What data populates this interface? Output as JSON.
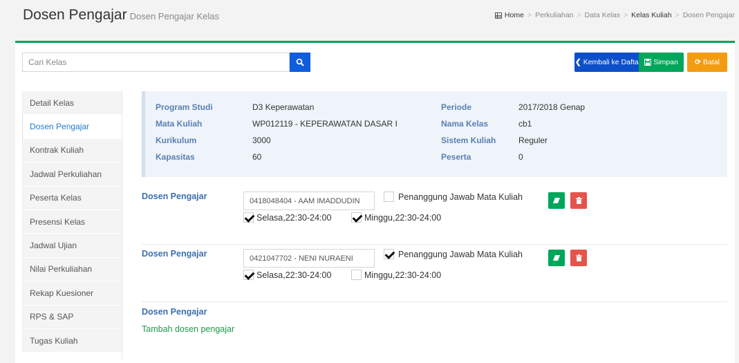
{
  "header": {
    "title": "Dosen Pengajar",
    "subtitle": "Dosen Pengajar Kelas",
    "breadcrumb": [
      "Home",
      "Perkuliahan",
      "Data Kelas",
      "Kelas Kuliah",
      "Dosen Pengajar"
    ]
  },
  "toolbar": {
    "search_placeholder": "Cari Kelas",
    "back_label": "Kembali ke Daftar",
    "save_label": "Simpan",
    "cancel_label": "Batal"
  },
  "sidebar": {
    "items": [
      {
        "label": "Detail Kelas",
        "active": false
      },
      {
        "label": "Dosen Pengajar",
        "active": true
      },
      {
        "label": "Kontrak Kuliah",
        "active": false
      },
      {
        "label": "Jadwal Perkuliahan",
        "active": false
      },
      {
        "label": "Peserta Kelas",
        "active": false
      },
      {
        "label": "Presensi Kelas",
        "active": false
      },
      {
        "label": "Jadwal Ujian",
        "active": false
      },
      {
        "label": "Nilai Perkuliahan",
        "active": false
      },
      {
        "label": "Rekap Kuesioner",
        "active": false
      },
      {
        "label": "RPS & SAP",
        "active": false
      },
      {
        "label": "Tugas Kuliah",
        "active": false
      }
    ]
  },
  "info": {
    "program_studi_label": "Program Studi",
    "program_studi": "D3 Keperawatan",
    "mata_kuliah_label": "Mata Kuliah",
    "mata_kuliah": "WP012119 - KEPERAWATAN DASAR I",
    "kurikulum_label": "Kurikulum",
    "kurikulum": "3000",
    "kapasitas_label": "Kapasitas",
    "kapasitas": "60",
    "periode_label": "Periode",
    "periode": "2017/2018 Genap",
    "nama_kelas_label": "Nama Kelas",
    "nama_kelas": "cb1",
    "sistem_kuliah_label": "Sistem Kuliah",
    "sistem_kuliah": "Reguler",
    "peserta_label": "Peserta",
    "peserta": "0"
  },
  "lecturers": [
    {
      "label": "Dosen Pengajar",
      "value": "0418048404 - AAM IMADDUDIN",
      "pj_label": "Penanggung Jawab Mata Kuliah",
      "pj_checked": false,
      "schedules": [
        {
          "label": "Selasa,22:30-24:00",
          "checked": true
        },
        {
          "label": "Minggu,22:30-24:00",
          "checked": true
        }
      ]
    },
    {
      "label": "Dosen Pengajar",
      "value": "0421047702 - NENI NURAENI",
      "pj_label": "Penanggung Jawab Mata Kuliah",
      "pj_checked": true,
      "schedules": [
        {
          "label": "Selasa,22:30-24:00",
          "checked": true
        },
        {
          "label": "Minggu,22:30-24:00",
          "checked": false
        }
      ]
    }
  ],
  "add_section": {
    "label": "Dosen Pengajar",
    "link": "Tambah dosen pengajar"
  },
  "colors": {
    "accent_green": "#00a65a",
    "primary_blue": "#0d4fc9",
    "warning_orange": "#f39c12",
    "danger_red": "#e5544b"
  }
}
